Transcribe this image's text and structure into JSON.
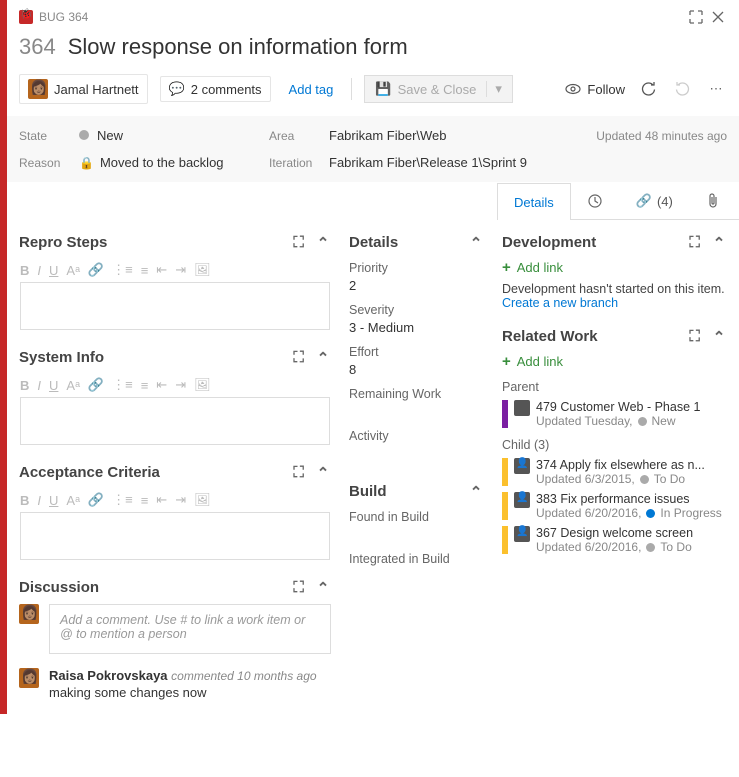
{
  "titlebar": {
    "label": "BUG 364"
  },
  "header": {
    "id": "364",
    "title": "Slow response on information form"
  },
  "cmdbar": {
    "assignee": "Jamal Hartnett",
    "comments_count": "2 comments",
    "add_tag": "Add tag",
    "save_close": "Save & Close",
    "follow": "Follow"
  },
  "meta": {
    "state_lbl": "State",
    "state_val": "New",
    "reason_lbl": "Reason",
    "reason_val": "Moved to the backlog",
    "area_lbl": "Area",
    "area_val": "Fabrikam Fiber\\Web",
    "iter_lbl": "Iteration",
    "iter_val": "Fabrikam Fiber\\Release 1\\Sprint 9",
    "updated": "Updated 48 minutes ago"
  },
  "tabs": {
    "details": "Details",
    "links": "(4)"
  },
  "sections": {
    "repro": "Repro Steps",
    "sysinfo": "System Info",
    "acceptance": "Acceptance Criteria",
    "discussion": "Discussion",
    "details": "Details",
    "build": "Build",
    "development": "Development",
    "related": "Related Work"
  },
  "details": {
    "priority_lbl": "Priority",
    "priority_val": "2",
    "severity_lbl": "Severity",
    "severity_val": "3 - Medium",
    "effort_lbl": "Effort",
    "effort_val": "8",
    "remaining_lbl": "Remaining Work",
    "activity_lbl": "Activity"
  },
  "build": {
    "found_lbl": "Found in Build",
    "integrated_lbl": "Integrated in Build"
  },
  "dev": {
    "add_link": "Add link",
    "not_started": "Development hasn't started on this item.",
    "create_branch": "Create a new branch"
  },
  "related": {
    "add_link": "Add link",
    "parent_lbl": "Parent",
    "parent": {
      "id": "479",
      "title": "Customer Web - Phase 1",
      "sub": "Updated Tuesday,",
      "state": "New"
    },
    "child_lbl": "Child (3)",
    "children": [
      {
        "id": "374",
        "title": "Apply fix elsewhere as n...",
        "sub": "Updated 6/3/2015,",
        "state": "To Do",
        "dot": ""
      },
      {
        "id": "383",
        "title": "Fix performance issues",
        "sub": "Updated 6/20/2016,",
        "state": "In Progress",
        "dot": "blue"
      },
      {
        "id": "367",
        "title": "Design welcome screen",
        "sub": "Updated 6/20/2016,",
        "state": "To Do",
        "dot": ""
      }
    ]
  },
  "discussion": {
    "placeholder": "Add a comment. Use # to link a work item or @ to mention a person",
    "comment": {
      "user": "Raisa Pokrovskaya",
      "meta": "commented 10 months ago",
      "body": "making some changes now"
    }
  }
}
